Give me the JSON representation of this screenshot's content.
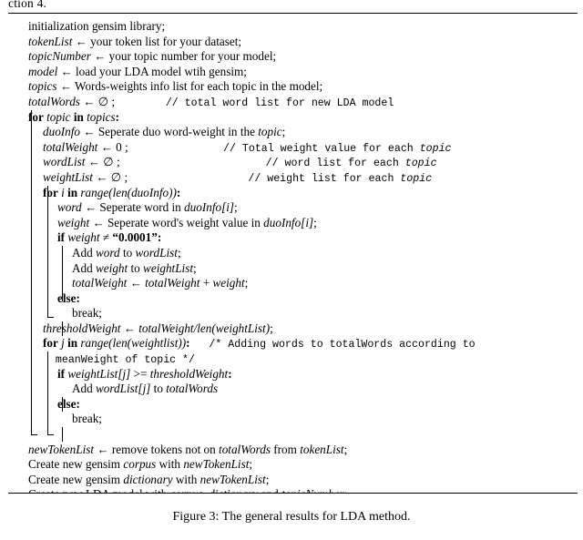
{
  "top_fragment": "ction 4.",
  "algorithm": {
    "lines": [
      {
        "indent": 0,
        "segments": [
          {
            "t": "initialization gensim library;",
            "s": "plain"
          }
        ]
      },
      {
        "indent": 0,
        "segments": [
          {
            "t": "tokenList",
            "s": "it"
          },
          {
            "t": " ← your token list for your dataset;",
            "s": "plain"
          }
        ]
      },
      {
        "indent": 0,
        "segments": [
          {
            "t": "topicNumber",
            "s": "it"
          },
          {
            "t": " ← your topic number for your model;",
            "s": "plain"
          }
        ]
      },
      {
        "indent": 0,
        "segments": [
          {
            "t": "model",
            "s": "it"
          },
          {
            "t": " ← load your LDA model wtih gensim;",
            "s": "plain"
          }
        ]
      },
      {
        "indent": 0,
        "segments": [
          {
            "t": "topics",
            "s": "it"
          },
          {
            "t": " ← Words-weights info list for each topic in the model;",
            "s": "plain"
          }
        ]
      },
      {
        "indent": 0,
        "segments": [
          {
            "t": "totalWords",
            "s": "it"
          },
          {
            "t": " ← ∅ ;",
            "s": "plain"
          },
          {
            "t": "        // total word list for new LDA model",
            "s": "cmt"
          }
        ]
      },
      {
        "indent": 0,
        "segments": [
          {
            "t": "for",
            "s": "bold"
          },
          {
            "t": " ",
            "s": "plain"
          },
          {
            "t": "topic",
            "s": "it"
          },
          {
            "t": " ",
            "s": "plain"
          },
          {
            "t": "in",
            "s": "bold"
          },
          {
            "t": " ",
            "s": "plain"
          },
          {
            "t": "topics",
            "s": "it"
          },
          {
            "t": ":",
            "s": "bold"
          }
        ]
      },
      {
        "indent": 1,
        "segments": [
          {
            "t": "duoInfo",
            "s": "it"
          },
          {
            "t": " ← Seperate duo word-weight in the ",
            "s": "plain"
          },
          {
            "t": "topic",
            "s": "it"
          },
          {
            "t": ";",
            "s": "plain"
          }
        ]
      },
      {
        "indent": 1,
        "segments": [
          {
            "t": "totalWeight",
            "s": "it"
          },
          {
            "t": " ← 0 ;",
            "s": "plain"
          },
          {
            "t": "               // Total weight value for each ",
            "s": "cmt"
          },
          {
            "t": "topic",
            "s": "cmt-it"
          }
        ]
      },
      {
        "indent": 1,
        "segments": [
          {
            "t": "wordList",
            "s": "it"
          },
          {
            "t": " ← ∅ ;",
            "s": "plain"
          },
          {
            "t": "                       // word list for each ",
            "s": "cmt"
          },
          {
            "t": "topic",
            "s": "cmt-it"
          }
        ]
      },
      {
        "indent": 1,
        "segments": [
          {
            "t": "weightList",
            "s": "it"
          },
          {
            "t": " ← ∅ ;",
            "s": "plain"
          },
          {
            "t": "                   // weight list for each ",
            "s": "cmt"
          },
          {
            "t": "topic",
            "s": "cmt-it"
          }
        ]
      },
      {
        "indent": 1,
        "segments": [
          {
            "t": "for",
            "s": "bold"
          },
          {
            "t": " ",
            "s": "plain"
          },
          {
            "t": "i",
            "s": "it"
          },
          {
            "t": " ",
            "s": "plain"
          },
          {
            "t": "in",
            "s": "bold"
          },
          {
            "t": " ",
            "s": "plain"
          },
          {
            "t": "range(len(duoInfo))",
            "s": "it"
          },
          {
            "t": ":",
            "s": "bold"
          }
        ]
      },
      {
        "indent": 2,
        "segments": [
          {
            "t": "word",
            "s": "it"
          },
          {
            "t": " ← Seperate word in ",
            "s": "plain"
          },
          {
            "t": "duoInfo[i]",
            "s": "it"
          },
          {
            "t": ";",
            "s": "plain"
          }
        ]
      },
      {
        "indent": 2,
        "segments": [
          {
            "t": "weight",
            "s": "it"
          },
          {
            "t": " ← Seperate word's weight value in ",
            "s": "plain"
          },
          {
            "t": "duoInfo[i]",
            "s": "it"
          },
          {
            "t": ";",
            "s": "plain"
          }
        ]
      },
      {
        "indent": 2,
        "segments": [
          {
            "t": "if",
            "s": "bold"
          },
          {
            "t": " ",
            "s": "plain"
          },
          {
            "t": "weight",
            "s": "it"
          },
          {
            "t": " ≠ ",
            "s": "plain"
          },
          {
            "t": "“0.0001”",
            "s": "bold"
          },
          {
            "t": ":",
            "s": "bold"
          }
        ]
      },
      {
        "indent": 3,
        "segments": [
          {
            "t": "Add ",
            "s": "plain"
          },
          {
            "t": "word",
            "s": "it"
          },
          {
            "t": " to ",
            "s": "plain"
          },
          {
            "t": "wordList",
            "s": "it"
          },
          {
            "t": ";",
            "s": "plain"
          }
        ]
      },
      {
        "indent": 3,
        "segments": [
          {
            "t": "Add ",
            "s": "plain"
          },
          {
            "t": "weight",
            "s": "it"
          },
          {
            "t": " to ",
            "s": "plain"
          },
          {
            "t": "weightList",
            "s": "it"
          },
          {
            "t": ";",
            "s": "plain"
          }
        ]
      },
      {
        "indent": 3,
        "segments": [
          {
            "t": "totalWeight",
            "s": "it"
          },
          {
            "t": " ← ",
            "s": "plain"
          },
          {
            "t": "totalWeight",
            "s": "it"
          },
          {
            "t": " + ",
            "s": "plain"
          },
          {
            "t": "weight",
            "s": "it"
          },
          {
            "t": ";",
            "s": "plain"
          }
        ]
      },
      {
        "indent": 2,
        "segments": [
          {
            "t": "else",
            "s": "bold"
          },
          {
            "t": ":",
            "s": "bold"
          }
        ]
      },
      {
        "indent": 3,
        "segments": [
          {
            "t": "break;",
            "s": "plain"
          }
        ]
      },
      {
        "indent": 1,
        "segments": [
          {
            "t": "thresholdWeight",
            "s": "it"
          },
          {
            "t": " ← ",
            "s": "plain"
          },
          {
            "t": "totalWeight/len(weightList)",
            "s": "it"
          },
          {
            "t": ";",
            "s": "plain"
          }
        ]
      },
      {
        "indent": 1,
        "segments": [
          {
            "t": "for",
            "s": "bold"
          },
          {
            "t": " ",
            "s": "plain"
          },
          {
            "t": "j",
            "s": "it"
          },
          {
            "t": " ",
            "s": "plain"
          },
          {
            "t": "in",
            "s": "bold"
          },
          {
            "t": " ",
            "s": "plain"
          },
          {
            "t": "range(len(weightlist))",
            "s": "it"
          },
          {
            "t": ":",
            "s": "bold"
          },
          {
            "t": "   /* Adding words to totalWords according to",
            "s": "cmt"
          }
        ]
      },
      {
        "indent": 1,
        "segments": [
          {
            "t": "  meanWeight of topic */",
            "s": "cmt"
          }
        ]
      },
      {
        "indent": 2,
        "segments": [
          {
            "t": "if",
            "s": "bold"
          },
          {
            "t": " ",
            "s": "plain"
          },
          {
            "t": "weightList[j]",
            "s": "it"
          },
          {
            "t": " >= ",
            "s": "plain"
          },
          {
            "t": "thresholdWeight",
            "s": "it"
          },
          {
            "t": ":",
            "s": "bold"
          }
        ]
      },
      {
        "indent": 3,
        "segments": [
          {
            "t": "Add ",
            "s": "plain"
          },
          {
            "t": "wordList[j]",
            "s": "it"
          },
          {
            "t": " to ",
            "s": "plain"
          },
          {
            "t": "totalWords",
            "s": "it"
          }
        ]
      },
      {
        "indent": 2,
        "segments": [
          {
            "t": "else",
            "s": "bold"
          },
          {
            "t": ":",
            "s": "bold"
          }
        ]
      },
      {
        "indent": 3,
        "segments": [
          {
            "t": "break;",
            "s": "plain"
          }
        ]
      }
    ],
    "trailing_lines": [
      {
        "segments": [
          {
            "t": "newTokenList",
            "s": "it"
          },
          {
            "t": " ← remove tokens not on ",
            "s": "plain"
          },
          {
            "t": "totalWords",
            "s": "it"
          },
          {
            "t": " from ",
            "s": "plain"
          },
          {
            "t": "tokenList",
            "s": "it"
          },
          {
            "t": ";",
            "s": "plain"
          }
        ]
      },
      {
        "segments": [
          {
            "t": "Create new gensim ",
            "s": "plain"
          },
          {
            "t": "corpus",
            "s": "it"
          },
          {
            "t": " with ",
            "s": "plain"
          },
          {
            "t": "newTokenList",
            "s": "it"
          },
          {
            "t": ";",
            "s": "plain"
          }
        ]
      },
      {
        "segments": [
          {
            "t": "Create new gensim ",
            "s": "plain"
          },
          {
            "t": "dictionary",
            "s": "it"
          },
          {
            "t": " with ",
            "s": "plain"
          },
          {
            "t": "newTokenList",
            "s": "it"
          },
          {
            "t": ";",
            "s": "plain"
          }
        ]
      },
      {
        "segments": [
          {
            "t": "Create new LDA model with ",
            "s": "plain"
          },
          {
            "t": "corpus",
            "s": "it"
          },
          {
            "t": ", ",
            "s": "plain"
          },
          {
            "t": "dictionary",
            "s": "it"
          },
          {
            "t": " and ",
            "s": "plain"
          },
          {
            "t": "topicNumber",
            "s": "it"
          },
          {
            "t": ";",
            "s": "plain"
          }
        ]
      }
    ]
  },
  "caption": "Figure 3: The general results for LDA method."
}
